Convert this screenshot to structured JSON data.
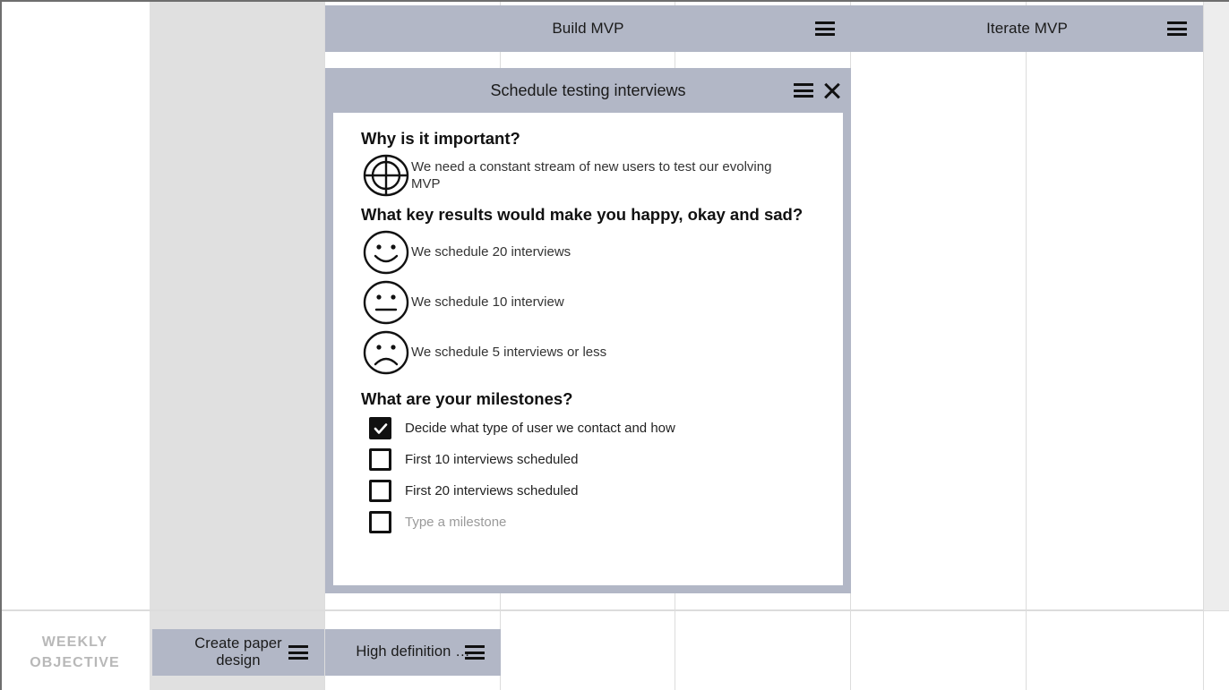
{
  "board": {
    "weekly_objective_line1": "WEEKLY",
    "weekly_objective_line2": "OBJECTIVE",
    "cards": [
      {
        "id": "build-mvp",
        "title": "Build MVP",
        "menu_icon": "hamburger-menu-icon"
      },
      {
        "id": "iterate-mvp",
        "title": "Iterate MVP",
        "menu_icon": "hamburger-menu-icon"
      },
      {
        "id": "create-paper",
        "title": "Create paper design",
        "menu_icon": "hamburger-menu-icon"
      },
      {
        "id": "high-def",
        "title": "High definition …",
        "menu_icon": "hamburger-menu-icon"
      }
    ]
  },
  "modal": {
    "title": "Schedule testing interviews",
    "menu_icon": "hamburger-menu-icon",
    "close_icon": "close-x-icon",
    "sections": {
      "why": {
        "heading": "Why is it important?",
        "icon": "target-icon",
        "text": "We need a constant stream of new users to test our evolving MVP"
      },
      "key_results": {
        "heading": "What key results would make you happy, okay and sad?",
        "items": [
          {
            "icon": "happy-face-icon",
            "text": "We schedule 20 interviews"
          },
          {
            "icon": "neutral-face-icon",
            "text": "We schedule 10 interview"
          },
          {
            "icon": "sad-face-icon",
            "text": "We schedule 5 interviews or less"
          }
        ]
      },
      "milestones": {
        "heading": "What are your milestones?",
        "items": [
          {
            "label": "Decide what type of user we contact and how",
            "checked": true,
            "placeholder": false
          },
          {
            "label": "First 10 interviews scheduled",
            "checked": false,
            "placeholder": false
          },
          {
            "label": "First 20 interviews scheduled",
            "checked": false,
            "placeholder": false
          },
          {
            "label": "Type a milestone",
            "checked": false,
            "placeholder": true
          }
        ]
      }
    }
  },
  "colors": {
    "card_bg": "#b2b7c6",
    "column_gray": "#e0e0e0",
    "grid_line": "#dcdcdc",
    "text_dark": "#1a1a1a",
    "placeholder_gray": "#9a9a9a"
  }
}
